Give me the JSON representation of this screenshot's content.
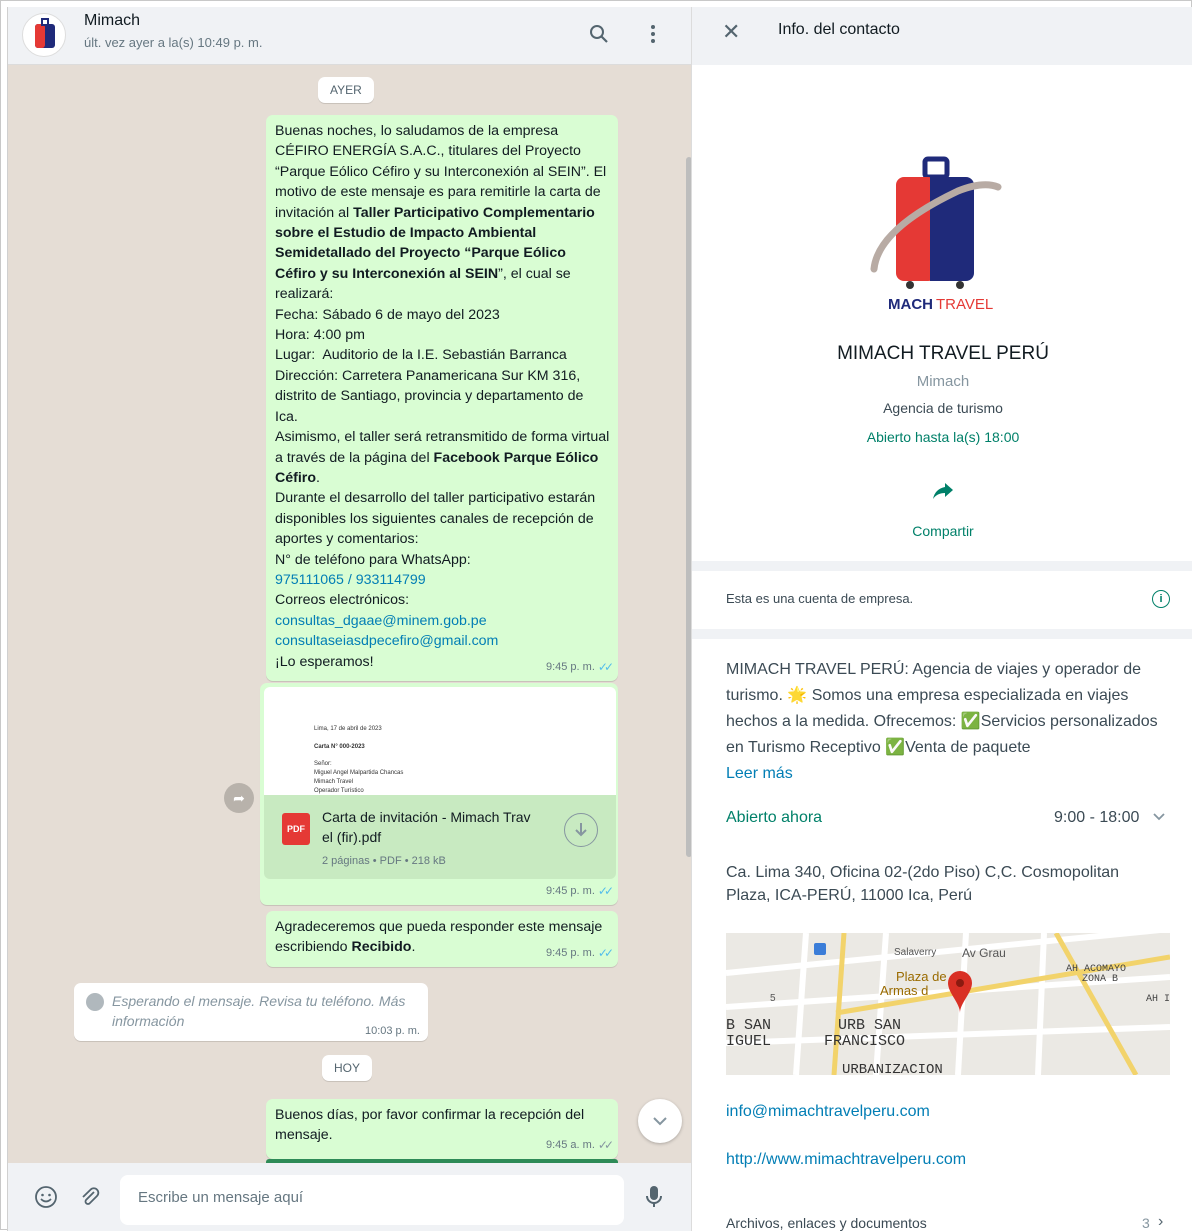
{
  "chat": {
    "name": "Mimach",
    "status": "últ. vez ayer a la(s) 10:49 p. m.",
    "day_yesterday": "AYER",
    "day_today": "HOY",
    "messages": {
      "m1_time": "9:45 p. m.",
      "m2_time": "9:45 p. m.",
      "m3_time": "9:45 p. m.",
      "m5_time": "9:45 a. m."
    },
    "document": {
      "filename_line1": "Carta de invitación - Mimach Trav",
      "filename_line2": "el (fir).pdf",
      "meta": "2 páginas • PDF • 218 kB",
      "preview_line1": "Lima, 17 de abril de 2023",
      "preview_line2": "Carta N° 000-2023",
      "preview_line3": "Señor:",
      "preview_line4": "Miguel Angel Malpartida Chancas",
      "preview_line5": "Mimach Travel",
      "preview_line6": "Operador Turístico"
    },
    "m3": {
      "text_a": "Agradeceremos que pueda responder este mensaje escribiendo ",
      "text_b": "Recibido",
      "text_c": "."
    },
    "waiting": {
      "text": "Esperando el mensaje. Revisa tu teléfono. Más información",
      "time": "10:03 p. m."
    },
    "m5": {
      "text": "Buenos días, por favor confirmar la recepción del mensaje."
    },
    "input_placeholder": "Escribe un mensaje aquí",
    "pdf_label": "PDF"
  },
  "m1": {
    "p1": "Buenas noches, lo saludamos de la empresa CÉFIRO ENERGÍA S.A.C., titulares del Proyecto “Parque Eólico Céfiro y su Interconexión al SEIN”. El motivo de este mensaje es para remitirle la carta de invitación al ",
    "b1": "Taller Participativo Complementario sobre el Estudio de Impacto Ambiental Semidetallado del Proyecto “Parque Eólico Céfiro y su Interconexión al SEIN",
    "p2": ", el cual se realizará:",
    "l1": "Fecha: Sábado 6 de mayo del 2023",
    "l2": "Hora: 4:00 pm",
    "l3": "Lugar:  Auditorio de la I.E. Sebastián Barranca",
    "l4": "Dirección: Carretera Panamericana Sur KM 316, distrito de Santiago, provincia y departamento de Ica.",
    "l5": "Asimismo, el taller será retransmitido de forma virtual a través de la página del ",
    "b2": "Facebook Parque Eólico Céfiro",
    "p3": ".",
    "l6": "Durante el desarrollo del taller participativo estarán disponibles los siguientes canales de recepción de aportes y comentarios:",
    "l7": "N° de teléfono para WhatsApp:",
    "phones": "975111065 / 933114799",
    "l8": "Correos electrónicos:",
    "email1": "consultas_dgaae@minem.gob.pe",
    "email2": "consultaseiasdpecefiro@gmail.com",
    "l9": "¡Lo esperamos!"
  },
  "info": {
    "title": "Info. del contacto",
    "logo_text_a": "MACH",
    "logo_text_b": "TRAVEL",
    "business_name": "MIMACH TRAVEL PERÚ",
    "push_name": "Mimach",
    "category": "Agencia de turismo",
    "hours_summary": "Abierto hasta la(s) 18:00",
    "share_label": "Compartir",
    "business_notice": "Esta es una cuenta de empresa.",
    "description": "MIMACH TRAVEL PERÚ: Agencia de viajes y operador de turismo. 🌟 Somos una empresa especializada en viajes hechos a la medida. Ofrecemos: ✅Servicios personalizados en Turismo Receptivo ✅Venta de paquete",
    "read_more": "Leer más",
    "open_now": "Abierto ahora",
    "hours": "9:00 - 18:00",
    "address": "Ca. Lima 340, Oficina 02-(2do Piso) C,C. Cosmopolitan Plaza, ICA-PERÚ, 11000 Ica, Perú",
    "email": "info@mimachtravelperu.com",
    "website": "http://www.mimachtravelperu.com",
    "files_label": "Archivos, enlaces y documentos",
    "files_count": "3",
    "map": {
      "label1": "Plaza de",
      "label2": "Armas d",
      "label3": "B SAN",
      "label4": "IGUEL",
      "label5": "URB SAN",
      "label6": "FRANCISCO",
      "label7": "URBANIZACION",
      "label8": "AH ACOMAYO",
      "label9": "ZONA B",
      "label10": "Av Grau",
      "label11": "Salaverry",
      "label12": "AH I",
      "label13": "5"
    }
  },
  "colors": {
    "accent": "#008069",
    "bubble_out": "#d9fdd3",
    "link": "#027eb5",
    "ticks": "#53bdeb"
  }
}
